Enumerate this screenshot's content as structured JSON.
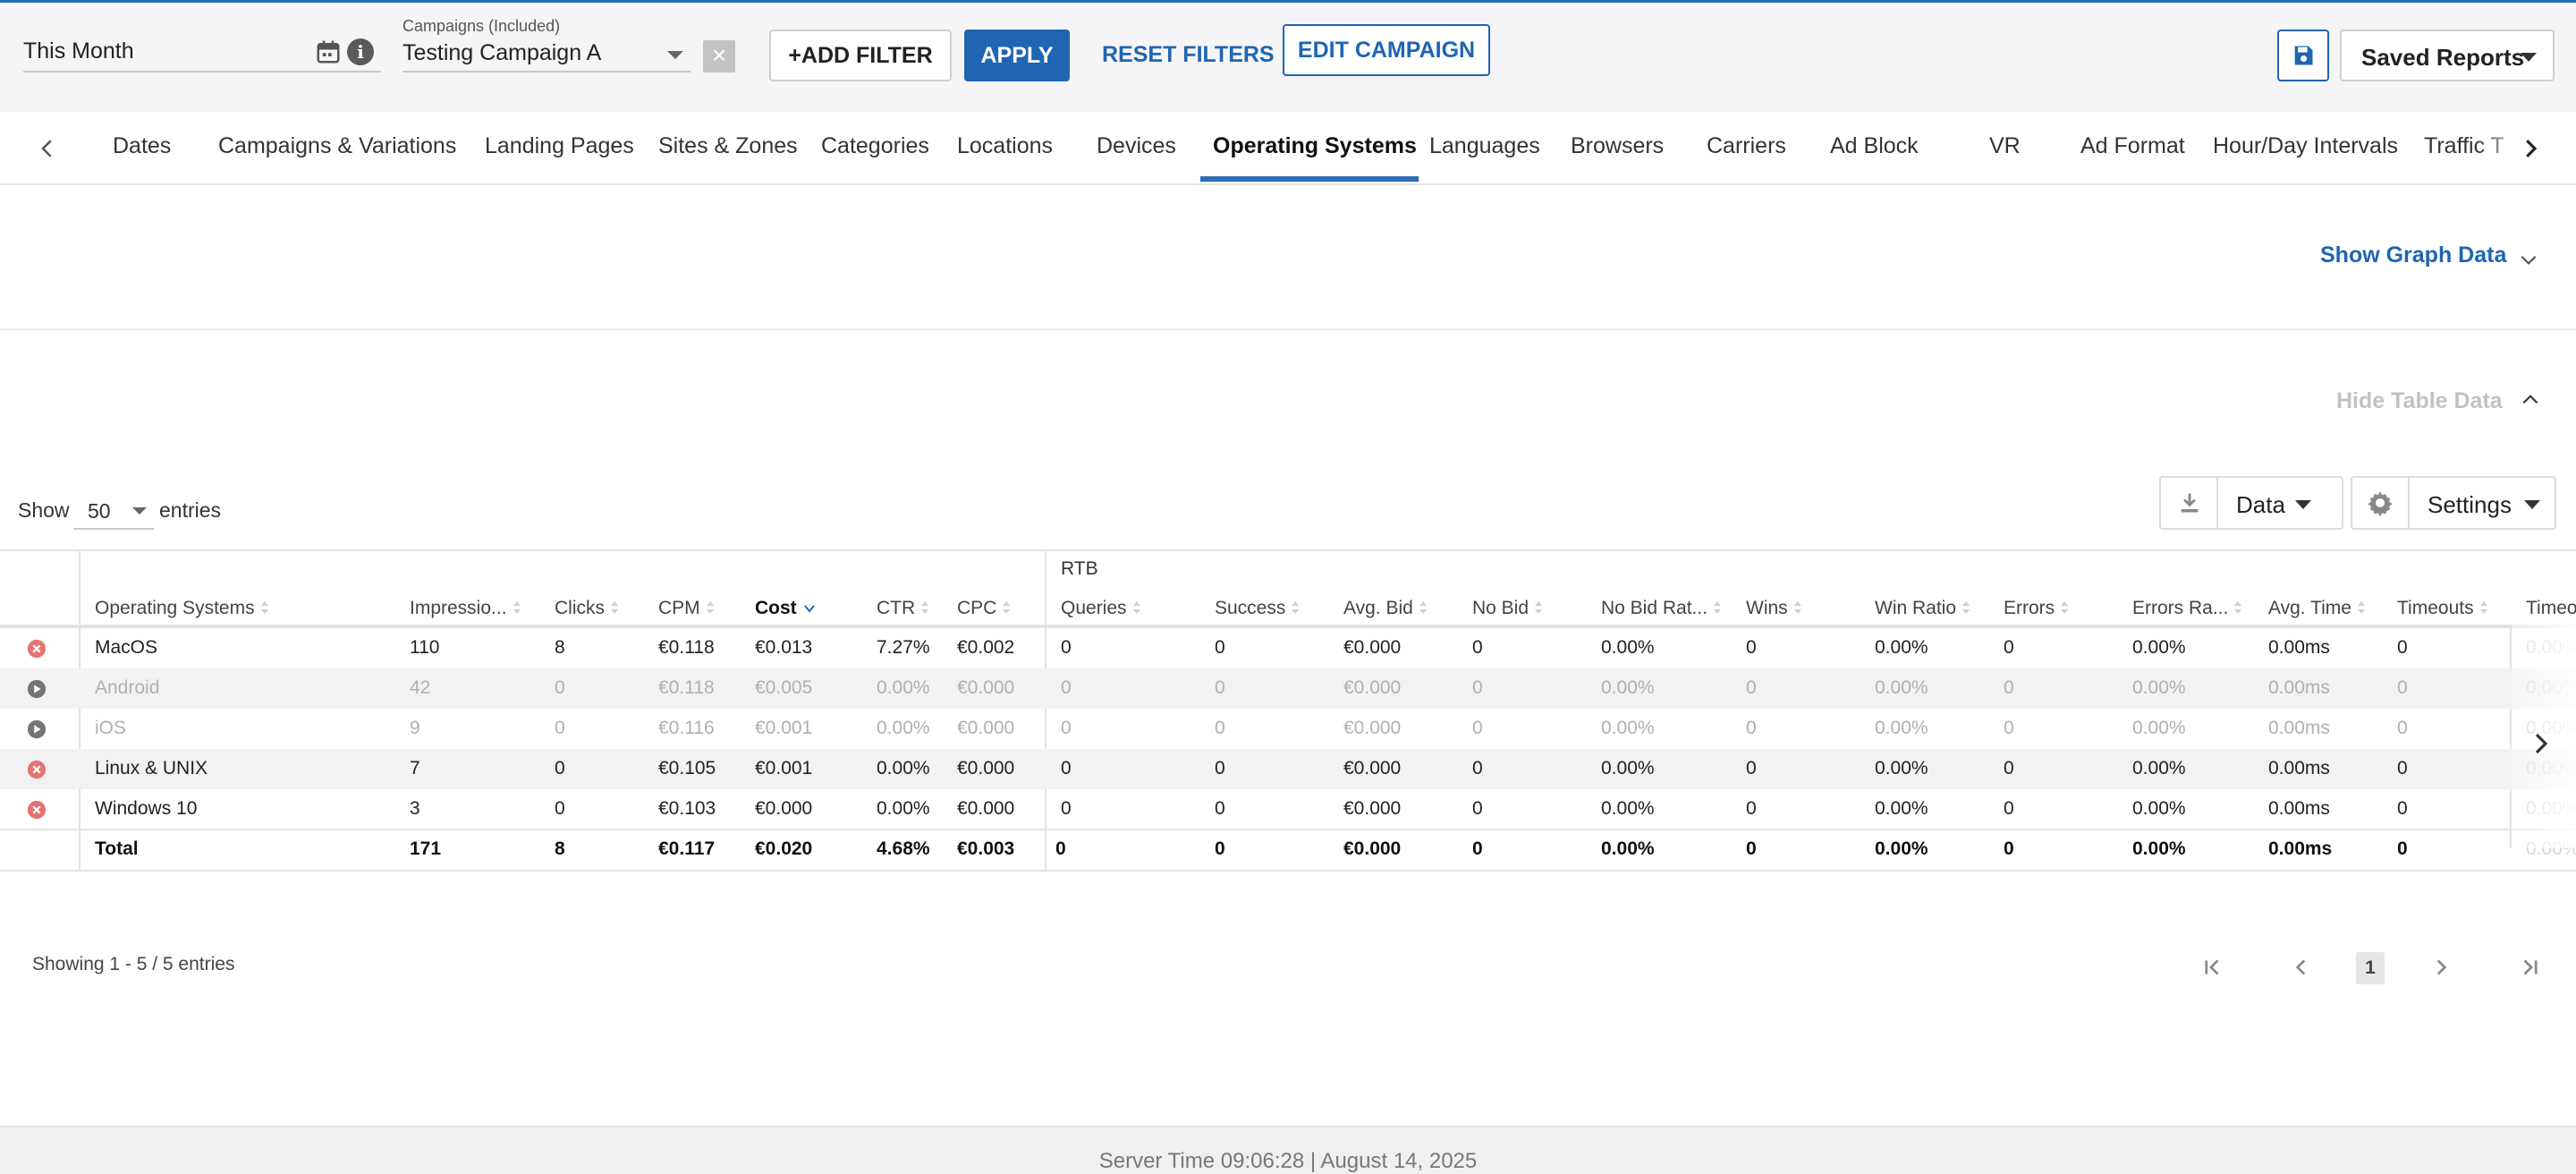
{
  "colors": {
    "accent": "#2065b2",
    "active_tab_underline": "#2a6cb5",
    "status_removed": "#e57373",
    "status_paused": "#757575"
  },
  "filters": {
    "date_range": "This Month",
    "campaigns_label": "Campaigns (Included)",
    "campaigns_value": "Testing Campaign A",
    "add_filter": "ADD FILTER",
    "apply": "APPLY",
    "reset_filters": "RESET FILTERS",
    "edit_campaign": "EDIT CAMPAIGN",
    "saved_reports": "Saved Reports"
  },
  "tabs": [
    "Dates",
    "Campaigns & Variations",
    "Landing Pages",
    "Sites & Zones",
    "Categories",
    "Locations",
    "Devices",
    "Operating Systems",
    "Languages",
    "Browsers",
    "Carriers",
    "Ad Block",
    "VR",
    "Ad Format",
    "Hour/Day Intervals",
    "Traffic T"
  ],
  "active_tab": "Operating Systems",
  "graph": {
    "toggle": "Show Graph Data"
  },
  "table_panel": {
    "toggle": "Hide Table Data"
  },
  "entries": {
    "show": "Show",
    "value": "50",
    "suffix": "entries"
  },
  "toolbar": {
    "data": "Data",
    "settings": "Settings"
  },
  "table": {
    "group_label": "RTB",
    "columns": [
      "Operating Systems",
      "Impressio...",
      "Clicks",
      "CPM",
      "Cost",
      "CTR",
      "CPC",
      "Queries",
      "Success",
      "Avg. Bid",
      "No Bid",
      "No Bid Rat...",
      "Wins",
      "Win Ratio",
      "Errors",
      "Errors Ra...",
      "Avg. Time",
      "Timeouts",
      "Timeo"
    ],
    "rows": [
      {
        "status": "removed",
        "cells": [
          "MacOS",
          "110",
          "8",
          "€0.118",
          "€0.013",
          "7.27%",
          "€0.002",
          "0",
          "0",
          "€0.000",
          "0",
          "0.00%",
          "0",
          "0.00%",
          "0",
          "0.00%",
          "0.00ms",
          "0",
          "0.00%"
        ]
      },
      {
        "status": "paused",
        "cells": [
          "Android",
          "42",
          "0",
          "€0.118",
          "€0.005",
          "0.00%",
          "€0.000",
          "0",
          "0",
          "€0.000",
          "0",
          "0.00%",
          "0",
          "0.00%",
          "0",
          "0.00%",
          "0.00ms",
          "0",
          "0.00%"
        ]
      },
      {
        "status": "paused",
        "cells": [
          "iOS",
          "9",
          "0",
          "€0.116",
          "€0.001",
          "0.00%",
          "€0.000",
          "0",
          "0",
          "€0.000",
          "0",
          "0.00%",
          "0",
          "0.00%",
          "0",
          "0.00%",
          "0.00ms",
          "0",
          "0.00%"
        ]
      },
      {
        "status": "removed",
        "cells": [
          "Linux & UNIX",
          "7",
          "0",
          "€0.105",
          "€0.001",
          "0.00%",
          "€0.000",
          "0",
          "0",
          "€0.000",
          "0",
          "0.00%",
          "0",
          "0.00%",
          "0",
          "0.00%",
          "0.00ms",
          "0",
          "0.00%"
        ]
      },
      {
        "status": "removed",
        "cells": [
          "Windows 10",
          "3",
          "0",
          "€0.103",
          "€0.000",
          "0.00%",
          "€0.000",
          "0",
          "0",
          "€0.000",
          "0",
          "0.00%",
          "0",
          "0.00%",
          "0",
          "0.00%",
          "0.00ms",
          "0",
          "0.00%"
        ]
      }
    ],
    "total": [
      "Total",
      "171",
      "8",
      "€0.117",
      "€0.020",
      "4.68%",
      "€0.003",
      "0",
      "0",
      "€0.000",
      "0",
      "0.00%",
      "0",
      "0.00%",
      "0",
      "0.00%",
      "0.00ms",
      "0",
      "0.00%"
    ]
  },
  "pagination": {
    "summary": "Showing 1 - 5 / 5 entries",
    "current_page": "1"
  },
  "footer": {
    "server_time": "Server Time 09:06:28 | August 14, 2025"
  }
}
